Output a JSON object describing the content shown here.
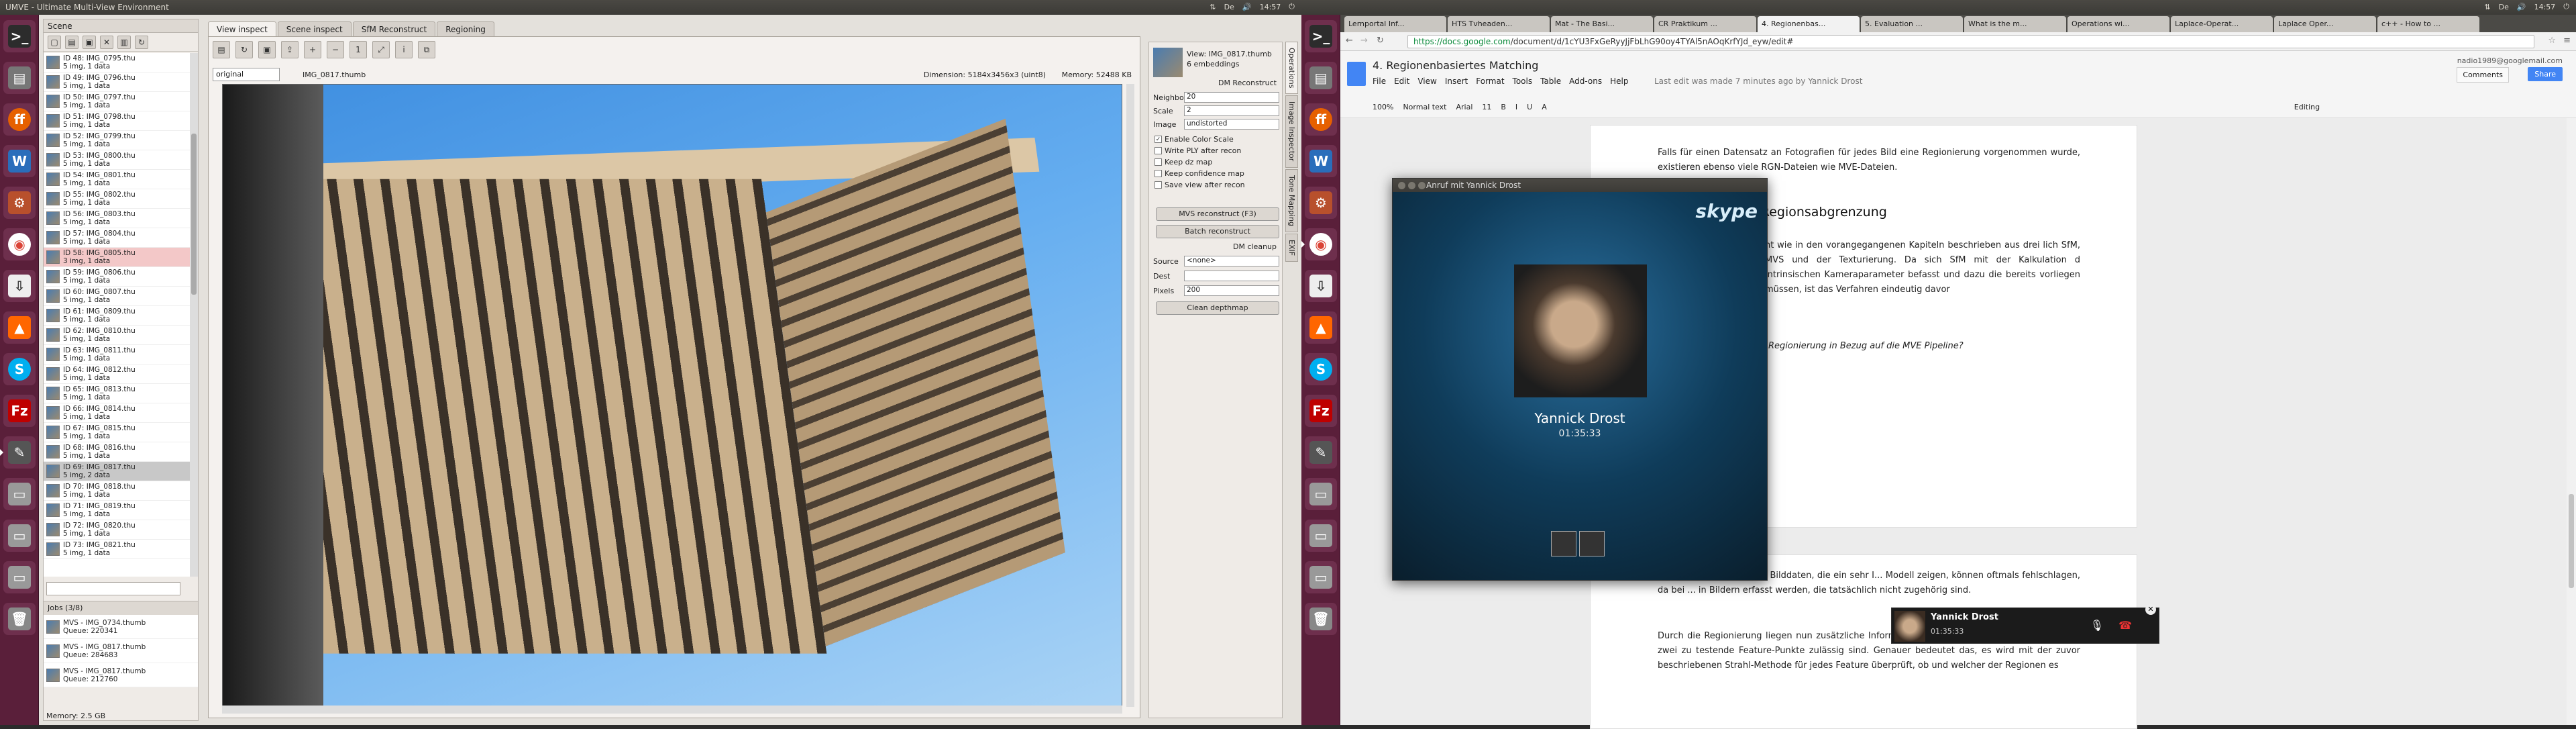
{
  "left_topbar": {
    "title": "UMVE - Ultimate Multi-View Environment",
    "time": "14:57"
  },
  "right_topbar": {
    "time": "14:57"
  },
  "launcher": [
    "terminal",
    "files",
    "firefox",
    "writer",
    "settings",
    "chrome",
    "updates",
    "vlc",
    "skype",
    "filezilla",
    "editor",
    "drive",
    "drive2",
    "drive3",
    "trash"
  ],
  "scene": {
    "title": "Scene",
    "views": [
      {
        "id": "ID 48: IMG_0795.thu",
        "info": "5 img, 1 data"
      },
      {
        "id": "ID 49: IMG_0796.thu",
        "info": "5 img, 1 data"
      },
      {
        "id": "ID 50: IMG_0797.thu",
        "info": "5 img, 1 data"
      },
      {
        "id": "ID 51: IMG_0798.thu",
        "info": "5 img, 1 data"
      },
      {
        "id": "ID 52: IMG_0799.thu",
        "info": "5 img, 1 data"
      },
      {
        "id": "ID 53: IMG_0800.thu",
        "info": "5 img, 1 data"
      },
      {
        "id": "ID 54: IMG_0801.thu",
        "info": "5 img, 1 data"
      },
      {
        "id": "ID 55: IMG_0802.thu",
        "info": "5 img, 1 data"
      },
      {
        "id": "ID 56: IMG_0803.thu",
        "info": "5 img, 1 data"
      },
      {
        "id": "ID 57: IMG_0804.thu",
        "info": "5 img, 1 data"
      },
      {
        "id": "ID 58: IMG_0805.thu",
        "info": "3 img, 1 data"
      },
      {
        "id": "ID 59: IMG_0806.thu",
        "info": "5 img, 1 data"
      },
      {
        "id": "ID 60: IMG_0807.thu",
        "info": "5 img, 1 data"
      },
      {
        "id": "ID 61: IMG_0809.thu",
        "info": "5 img, 1 data"
      },
      {
        "id": "ID 62: IMG_0810.thu",
        "info": "5 img, 1 data"
      },
      {
        "id": "ID 63: IMG_0811.thu",
        "info": "5 img, 1 data"
      },
      {
        "id": "ID 64: IMG_0812.thu",
        "info": "5 img, 1 data"
      },
      {
        "id": "ID 65: IMG_0813.thu",
        "info": "5 img, 1 data"
      },
      {
        "id": "ID 66: IMG_0814.thu",
        "info": "5 img, 1 data"
      },
      {
        "id": "ID 67: IMG_0815.thu",
        "info": "5 img, 1 data"
      },
      {
        "id": "ID 68: IMG_0816.thu",
        "info": "5 img, 1 data"
      },
      {
        "id": "ID 69: IMG_0817.thu",
        "info": "5 img, 2 data"
      },
      {
        "id": "ID 70: IMG_0818.thu",
        "info": "5 img, 1 data"
      },
      {
        "id": "ID 71: IMG_0819.thu",
        "info": "5 img, 1 data"
      },
      {
        "id": "ID 72: IMG_0820.thu",
        "info": "5 img, 1 data"
      },
      {
        "id": "ID 73: IMG_0821.thu",
        "info": "5 img, 1 data"
      }
    ],
    "jobs_title": "Jobs (3/8)",
    "jobs": [
      {
        "name": "MVS - IMG_0734.thumb",
        "queue": "Queue: 220341"
      },
      {
        "name": "MVS - IMG_0817.thumb",
        "queue": "Queue: 284683"
      },
      {
        "name": "MVS - IMG_0817.thumb",
        "queue": "Queue: 212760"
      }
    ],
    "memory": "Memory: 2.5 GB"
  },
  "tabs": [
    "View inspect",
    "Scene inspect",
    "SfM Reconstruct",
    "Regioning"
  ],
  "view": {
    "select": "original",
    "name": "IMG_0817.thumb",
    "dimension": "Dimension: 5184x3456x3 (uint8)",
    "memory": "Memory: 52488 KB"
  },
  "dm": {
    "view": "View: IMG_0817.thumb",
    "embeddings": "6 embeddings",
    "section": "DM Reconstruct",
    "neighbors_label": "Neighbors",
    "neighbors": "20",
    "scale_label": "Scale",
    "scale": "2",
    "image_label": "Image",
    "image": "undistorted",
    "checks": [
      {
        "label": "Enable Color Scale",
        "checked": true
      },
      {
        "label": "Write PLY after recon",
        "checked": false
      },
      {
        "label": "Keep dz map",
        "checked": false
      },
      {
        "label": "Keep confidence map",
        "checked": false
      },
      {
        "label": "Save view after recon",
        "checked": false
      }
    ],
    "btn_mvs": "MVS reconstruct (F3)",
    "btn_batch": "Batch reconstruct",
    "cleanup": "DM cleanup",
    "source_label": "Source",
    "source": "<none>",
    "dest_label": "Dest",
    "dest": "",
    "pixels_label": "Pixels",
    "pixels": "200",
    "btn_clean": "Clean depthmap"
  },
  "vtabs": [
    "Operations",
    "Image Inspector",
    "Tone Mapping",
    "EXIF"
  ],
  "chrome": {
    "tabs": [
      "Lernportal Inf...",
      "HTS Tvheaden...",
      "Mat - The Basi...",
      "CR Praktikum ...",
      "4. Regionenbas...",
      "5. Evaluation ...",
      "What is the m...",
      "Operations wi...",
      "Laplace-Operat...",
      "Laplace Oper...",
      "c++ - How to ..."
    ],
    "url_host": "https://docs.google.com",
    "url_path": "/document/d/1cYU3FxGeRyyJjFbLhG90oy4TYAl5nAOqKrfYJd_eyw/edit#",
    "doc_title": "4. Regionenbasiertes Matching",
    "menu": [
      "File",
      "Edit",
      "View",
      "Insert",
      "Format",
      "Tools",
      "Table",
      "Add-ons",
      "Help"
    ],
    "last_edit": "Last edit was made 7 minutes ago by Yannick Drost",
    "user": "nadio1989@googlemail.com",
    "comments": "Comments",
    "share": "Share",
    "toolbar": [
      "100%",
      "Normal text",
      "Arial",
      "11",
      "B",
      "I",
      "U",
      "A",
      "Editing"
    ],
    "p1": "Falls für einen Datensatz an Fotografien für jedes Bild eine Regionierung vorgenommen wurde, existieren ebenso viele RGN-Dateien wie MVE-Dateien.",
    "h": "r Regionsabgrenzung",
    "p2": "ht wie in den vorangegangenen Kapiteln beschrieben aus drei lich SfM, MVS und der Texturierung. Da sich SfM mit der Kalkulation d intrinsischen Kameraparameter befasst und dazu die bereits vorliegen müssen, ist das Verfahren eindeutig davor",
    "p3": "Regionierung in Bezug auf die MVE Pipeline?",
    "p4": "Rekonstruktionen mittels Bilddaten, die ein sehr I... Modell zeigen, können oftmals fehlschlagen, da bei ... in Bildern erfasst werden, die tatsächlich nicht zugehörig sind.",
    "p5": "Durch die Regionierung liegen nun zusätzliche Informationen vor mit denen überprüft wird, ob zwei zu testende Feature-Punkte zulässig sind. Genauer bedeutet das, es wird mit der zuvor beschriebenen Strahl-Methode für jedes Feature überprüft, ob und welcher der Regionen es"
  },
  "skype": {
    "title": "Anruf mit Yannick Drost",
    "logo": "skype",
    "name": "Yannick Drost",
    "time": "01:35:33"
  },
  "notif": {
    "name": "Yannick Drost",
    "time": "01:35:33"
  },
  "colors": {
    "launcher": "#5a1f3a",
    "accent": "#4285f4",
    "skype_bg": "#0f3c5a"
  }
}
